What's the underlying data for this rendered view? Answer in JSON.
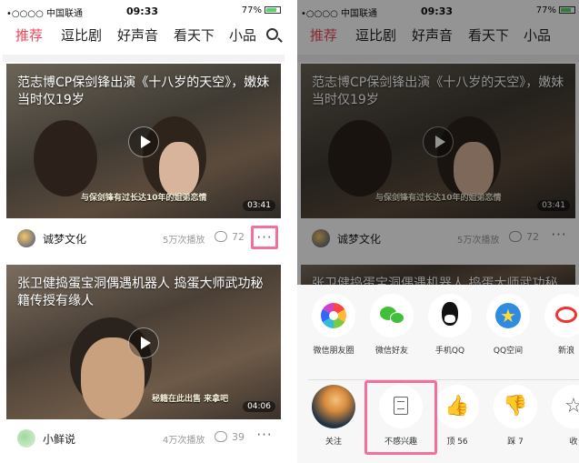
{
  "status_bar": {
    "carrier": "•○○○○ 中国联通",
    "time": "09:33",
    "battery": "77%"
  },
  "tabs": [
    "推荐",
    "逗比剧",
    "好声音",
    "看天下",
    "小品"
  ],
  "videos": [
    {
      "title": "范志博CP保剑锋出演《十八岁的天空》，嫩妹当时仅19岁",
      "subtitle": "与保剑锋有过长达10年的姐弟恋情",
      "duration": "03:41",
      "author": "诚梦文化",
      "plays": "5万次播放",
      "comments": "72"
    },
    {
      "title": "张卫健捣蛋宝洞偶遇机器人 捣蛋大师武功秘籍传授有缘人",
      "subtitle": "秘籍在此出售  来拿吧",
      "duration": "04:06",
      "author": "小鲜说",
      "plays": "4万次播放",
      "comments": "39"
    }
  ],
  "more_label": "···",
  "share_sheet": {
    "share_targets": [
      {
        "label": "微信朋友圈",
        "icon": "moments-icon"
      },
      {
        "label": "微信好友",
        "icon": "wechat-icon"
      },
      {
        "label": "手机QQ",
        "icon": "qq-icon"
      },
      {
        "label": "QQ空间",
        "icon": "qzone-icon"
      },
      {
        "label": "新浪",
        "icon": "weibo-icon"
      }
    ],
    "actions": [
      {
        "label": "关注",
        "icon": "follow-avatar"
      },
      {
        "label": "不感兴趣",
        "icon": "not-interested-icon"
      },
      {
        "label": "顶 56",
        "icon": "thumb-up-icon",
        "glyph": "👍"
      },
      {
        "label": "踩 7",
        "icon": "thumb-down-icon",
        "glyph": "👎"
      },
      {
        "label": "收",
        "icon": "favorite-icon",
        "glyph": "☆"
      }
    ]
  },
  "colors": {
    "accent": "#f0455a",
    "highlight": "#f36fa0"
  }
}
